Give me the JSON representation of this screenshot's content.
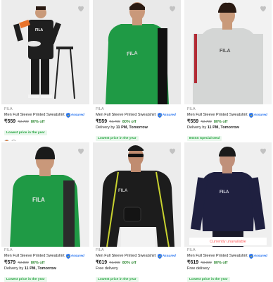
{
  "products": [
    {
      "brand": "FILA",
      "title": "Men Full Sleeve Printed Sweatshirt",
      "assured": "Assured",
      "price": "₹559",
      "mrp": "₹2,799",
      "discount": "80% off",
      "delivery_prefix": "",
      "delivery_bold": "",
      "badge": "Lowest price in the year",
      "swatches": [
        "#e8732a",
        "#f4f4f4"
      ],
      "unavailable": "",
      "colors": {
        "bg": "#ececec",
        "top": "#1f1f1f",
        "stripe": "#e8732a",
        "pants": "#1a1a1a",
        "skin": "#c99a7a"
      }
    },
    {
      "brand": "FILA",
      "title": "Men Full Sleeve Printed Sweatshirt",
      "assured": "Assured",
      "price": "₹559",
      "mrp": "₹2,799",
      "discount": "80% off",
      "delivery_prefix": "Delivery by ",
      "delivery_bold": "11 PM, Tomorrow",
      "badge": "Lowest price in the year",
      "swatches": [],
      "unavailable": "",
      "colors": {
        "bg": "#e9e9e9",
        "top": "#1f9a45",
        "stripe": "#111111",
        "pants": "#1a1a1a",
        "skin": "#c9987a"
      }
    },
    {
      "brand": "FILA",
      "title": "Men Full Sleeve Printed Sweatshirt",
      "assured": "Assured",
      "price": "₹559",
      "mrp": "₹2,799",
      "discount": "80% off",
      "delivery_prefix": "Delivery by ",
      "delivery_bold": "11 PM, Tomorrow",
      "badge": "BOSS Special Deal",
      "swatches": [],
      "unavailable": "",
      "colors": {
        "bg": "#f2f2f2",
        "top": "#d4d6d5",
        "stripe": "#b22b35",
        "pants": "#8a8a8a",
        "skin": "#c99a7a"
      }
    },
    {
      "brand": "FILA",
      "title": "Men Full Sleeve Printed Sweatshirt",
      "assured": "Assured",
      "price": "₹579",
      "mrp": "₹2,899",
      "discount": "80% off",
      "delivery_prefix": "Delivery by ",
      "delivery_bold": "11 PM, Tomorrow",
      "badge": "Lowest price in the year",
      "swatches": [],
      "unavailable": "",
      "colors": {
        "bg": "#efefef",
        "top": "#1f9a45",
        "stripe": "#2b2b2b",
        "pants": "#333333",
        "skin": "#c9987a"
      }
    },
    {
      "brand": "FILA",
      "title": "Men Full Sleeve Printed Sweatshirt",
      "assured": "Assured",
      "price": "₹619",
      "mrp": "₹3,099",
      "discount": "80% off",
      "delivery_prefix": "Free delivery",
      "delivery_bold": "",
      "badge": "Lowest price in the year",
      "swatches": [],
      "unavailable": "",
      "colors": {
        "bg": "#ececec",
        "top": "#1c1c1c",
        "stripe": "#c8d22f",
        "pants": "#f2f2f2",
        "skin": "#c08c70"
      }
    },
    {
      "brand": "FILA",
      "title": "Men Full Sleeve Printed Sweatshirt",
      "assured": "Assured",
      "price": "₹619",
      "mrp": "₹3,099",
      "discount": "80% off",
      "delivery_prefix": "Free delivery",
      "delivery_bold": "",
      "badge": "Lowest price in the year",
      "swatches": [],
      "unavailable": "Currently unavailable",
      "colors": {
        "bg": "#efefef",
        "top": "#1f2040",
        "stripe": "#1f2040",
        "pants": "#1a1a2a",
        "skin": "#c0907a"
      }
    }
  ]
}
